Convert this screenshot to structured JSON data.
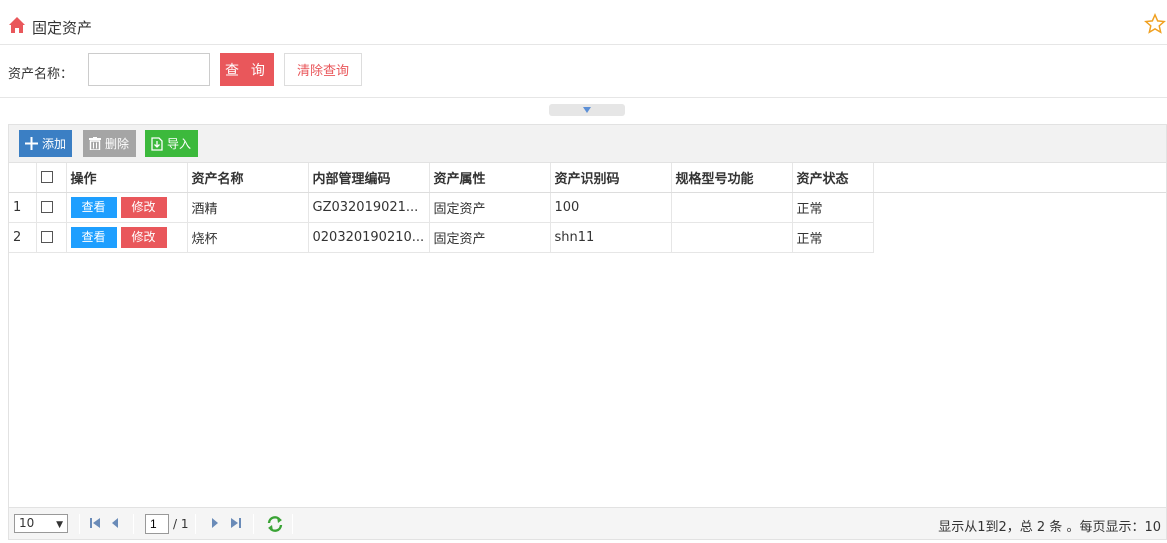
{
  "header": {
    "title": "固定资产",
    "home_icon": "home-icon",
    "favorite_icon": "star-icon"
  },
  "search": {
    "label": "资产名称：",
    "value": "",
    "placeholder": "",
    "query_label": "查 询",
    "clear_label": "清除查询"
  },
  "toolbar": {
    "add_label": "添加",
    "delete_label": "删除",
    "import_label": "导入"
  },
  "table": {
    "columns": [
      "操作",
      "资产名称",
      "内部管理编码",
      "资产属性",
      "资产识别码",
      "规格型号功能",
      "资产状态"
    ],
    "view_label": "查看",
    "edit_label": "修改",
    "rows": [
      {
        "index": "1",
        "name": "酒精",
        "code": "GZ032019021...",
        "attribute": "固定资产",
        "id_code": "100",
        "spec": "",
        "status": "正常"
      },
      {
        "index": "2",
        "name": "烧杯",
        "code": "020320190210...",
        "attribute": "固定资产",
        "id_code": "shn11",
        "spec": "",
        "status": "正常"
      }
    ]
  },
  "pager": {
    "page_size": "10",
    "current_page": "1",
    "total_pages": "/ 1",
    "info": "显示从1到2，总 2 条 。每页显示：10"
  },
  "colors": {
    "query_button": "#e9575b",
    "add_button": "#3b7fc4",
    "delete_button": "#a5a5a5",
    "import_button": "#3cb93c",
    "view_button": "#1e9fff",
    "edit_button": "#e9575b"
  }
}
